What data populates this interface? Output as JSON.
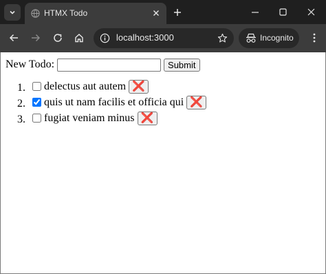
{
  "browser": {
    "tab_title": "HTMX Todo",
    "url": "localhost:3000",
    "incognito_label": "Incognito"
  },
  "form": {
    "label": "New Todo:",
    "input_value": "",
    "submit_label": "Submit"
  },
  "todos": [
    {
      "text": "delectus aut autem",
      "done": false
    },
    {
      "text": "quis ut nam facilis et officia qui",
      "done": true
    },
    {
      "text": "fugiat veniam minus",
      "done": false
    }
  ],
  "delete_glyph": "❌",
  "colors": {
    "delete_red": "#f0386b",
    "chrome_dark": "#1f1f1f",
    "toolbar": "#3c3c3c",
    "checkbox_blue": "#1a73e8"
  }
}
